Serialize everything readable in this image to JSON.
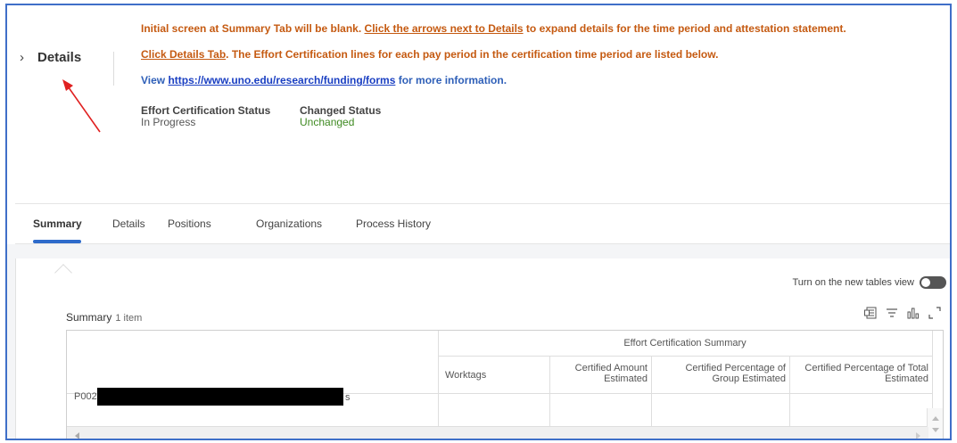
{
  "header": {
    "details_label": "Details",
    "instructions": {
      "line1_part1": "Initial screen at Summary Tab will be blank. ",
      "line1_underlined": "Click the arrows next to Details",
      "line1_part2": " to expand details for the time period and attestation statement.",
      "line2_underlined": "Click Details Tab",
      "line2_part2": ". The Effort Certification lines for each pay period in the certification time period are listed below.",
      "line3_part1": "View ",
      "line3_link": "https://www.uno.edu/research/funding/forms",
      "line3_part2": " for more information."
    },
    "effort_status_label": "Effort Certification Status",
    "effort_status_value": "In Progress",
    "changed_status_label": "Changed Status",
    "changed_status_value": "Unchanged"
  },
  "tabs": [
    {
      "label": "Summary",
      "active": true
    },
    {
      "label": "Details",
      "active": false
    },
    {
      "label": "Positions",
      "active": false
    },
    {
      "label": "Organizations",
      "active": false
    },
    {
      "label": "Process History",
      "active": false
    }
  ],
  "summary": {
    "toggle_label": "Turn on the new tables view",
    "title": "Summary",
    "count": "1 item",
    "group_header": "Effort Certification Summary",
    "columns": [
      "Worktags",
      "Certified Amount Estimated",
      "Certified Percentage of Group Estimated",
      "Certified Percentage of Total Estimated"
    ],
    "row_prefix": "P002",
    "row_suffix": "s"
  },
  "icons": [
    "chevron-right-icon",
    "export-excel-icon",
    "filter-icon",
    "chart-icon",
    "fullscreen-icon",
    "scroll-up-icon",
    "scroll-down-icon",
    "scroll-left-icon",
    "scroll-right-icon"
  ],
  "colors": {
    "orange": "#c55a11",
    "link": "#1a3fc2",
    "green": "#3f8a22",
    "accent": "#2e6bcb",
    "frame": "#3f6fc8"
  }
}
